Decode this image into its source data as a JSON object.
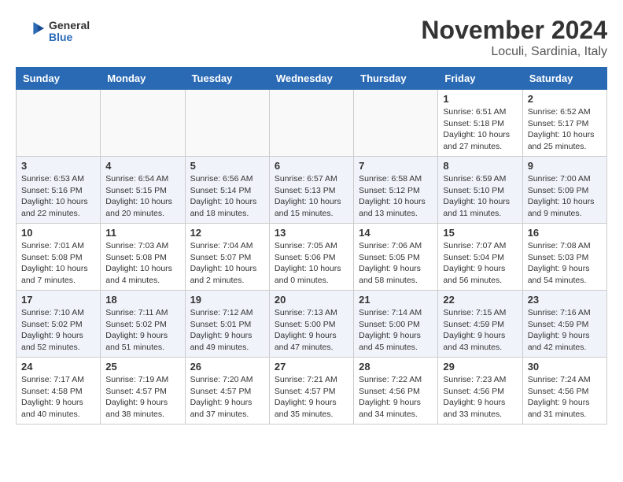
{
  "header": {
    "logo": {
      "general": "General",
      "blue": "Blue"
    },
    "title": "November 2024",
    "location": "Loculi, Sardinia, Italy"
  },
  "weekdays": [
    "Sunday",
    "Monday",
    "Tuesday",
    "Wednesday",
    "Thursday",
    "Friday",
    "Saturday"
  ],
  "weeks": [
    [
      {
        "day": "",
        "info": ""
      },
      {
        "day": "",
        "info": ""
      },
      {
        "day": "",
        "info": ""
      },
      {
        "day": "",
        "info": ""
      },
      {
        "day": "",
        "info": ""
      },
      {
        "day": "1",
        "info": "Sunrise: 6:51 AM\nSunset: 5:18 PM\nDaylight: 10 hours and 27 minutes."
      },
      {
        "day": "2",
        "info": "Sunrise: 6:52 AM\nSunset: 5:17 PM\nDaylight: 10 hours and 25 minutes."
      }
    ],
    [
      {
        "day": "3",
        "info": "Sunrise: 6:53 AM\nSunset: 5:16 PM\nDaylight: 10 hours and 22 minutes."
      },
      {
        "day": "4",
        "info": "Sunrise: 6:54 AM\nSunset: 5:15 PM\nDaylight: 10 hours and 20 minutes."
      },
      {
        "day": "5",
        "info": "Sunrise: 6:56 AM\nSunset: 5:14 PM\nDaylight: 10 hours and 18 minutes."
      },
      {
        "day": "6",
        "info": "Sunrise: 6:57 AM\nSunset: 5:13 PM\nDaylight: 10 hours and 15 minutes."
      },
      {
        "day": "7",
        "info": "Sunrise: 6:58 AM\nSunset: 5:12 PM\nDaylight: 10 hours and 13 minutes."
      },
      {
        "day": "8",
        "info": "Sunrise: 6:59 AM\nSunset: 5:10 PM\nDaylight: 10 hours and 11 minutes."
      },
      {
        "day": "9",
        "info": "Sunrise: 7:00 AM\nSunset: 5:09 PM\nDaylight: 10 hours and 9 minutes."
      }
    ],
    [
      {
        "day": "10",
        "info": "Sunrise: 7:01 AM\nSunset: 5:08 PM\nDaylight: 10 hours and 7 minutes."
      },
      {
        "day": "11",
        "info": "Sunrise: 7:03 AM\nSunset: 5:08 PM\nDaylight: 10 hours and 4 minutes."
      },
      {
        "day": "12",
        "info": "Sunrise: 7:04 AM\nSunset: 5:07 PM\nDaylight: 10 hours and 2 minutes."
      },
      {
        "day": "13",
        "info": "Sunrise: 7:05 AM\nSunset: 5:06 PM\nDaylight: 10 hours and 0 minutes."
      },
      {
        "day": "14",
        "info": "Sunrise: 7:06 AM\nSunset: 5:05 PM\nDaylight: 9 hours and 58 minutes."
      },
      {
        "day": "15",
        "info": "Sunrise: 7:07 AM\nSunset: 5:04 PM\nDaylight: 9 hours and 56 minutes."
      },
      {
        "day": "16",
        "info": "Sunrise: 7:08 AM\nSunset: 5:03 PM\nDaylight: 9 hours and 54 minutes."
      }
    ],
    [
      {
        "day": "17",
        "info": "Sunrise: 7:10 AM\nSunset: 5:02 PM\nDaylight: 9 hours and 52 minutes."
      },
      {
        "day": "18",
        "info": "Sunrise: 7:11 AM\nSunset: 5:02 PM\nDaylight: 9 hours and 51 minutes."
      },
      {
        "day": "19",
        "info": "Sunrise: 7:12 AM\nSunset: 5:01 PM\nDaylight: 9 hours and 49 minutes."
      },
      {
        "day": "20",
        "info": "Sunrise: 7:13 AM\nSunset: 5:00 PM\nDaylight: 9 hours and 47 minutes."
      },
      {
        "day": "21",
        "info": "Sunrise: 7:14 AM\nSunset: 5:00 PM\nDaylight: 9 hours and 45 minutes."
      },
      {
        "day": "22",
        "info": "Sunrise: 7:15 AM\nSunset: 4:59 PM\nDaylight: 9 hours and 43 minutes."
      },
      {
        "day": "23",
        "info": "Sunrise: 7:16 AM\nSunset: 4:59 PM\nDaylight: 9 hours and 42 minutes."
      }
    ],
    [
      {
        "day": "24",
        "info": "Sunrise: 7:17 AM\nSunset: 4:58 PM\nDaylight: 9 hours and 40 minutes."
      },
      {
        "day": "25",
        "info": "Sunrise: 7:19 AM\nSunset: 4:57 PM\nDaylight: 9 hours and 38 minutes."
      },
      {
        "day": "26",
        "info": "Sunrise: 7:20 AM\nSunset: 4:57 PM\nDaylight: 9 hours and 37 minutes."
      },
      {
        "day": "27",
        "info": "Sunrise: 7:21 AM\nSunset: 4:57 PM\nDaylight: 9 hours and 35 minutes."
      },
      {
        "day": "28",
        "info": "Sunrise: 7:22 AM\nSunset: 4:56 PM\nDaylight: 9 hours and 34 minutes."
      },
      {
        "day": "29",
        "info": "Sunrise: 7:23 AM\nSunset: 4:56 PM\nDaylight: 9 hours and 33 minutes."
      },
      {
        "day": "30",
        "info": "Sunrise: 7:24 AM\nSunset: 4:56 PM\nDaylight: 9 hours and 31 minutes."
      }
    ]
  ]
}
